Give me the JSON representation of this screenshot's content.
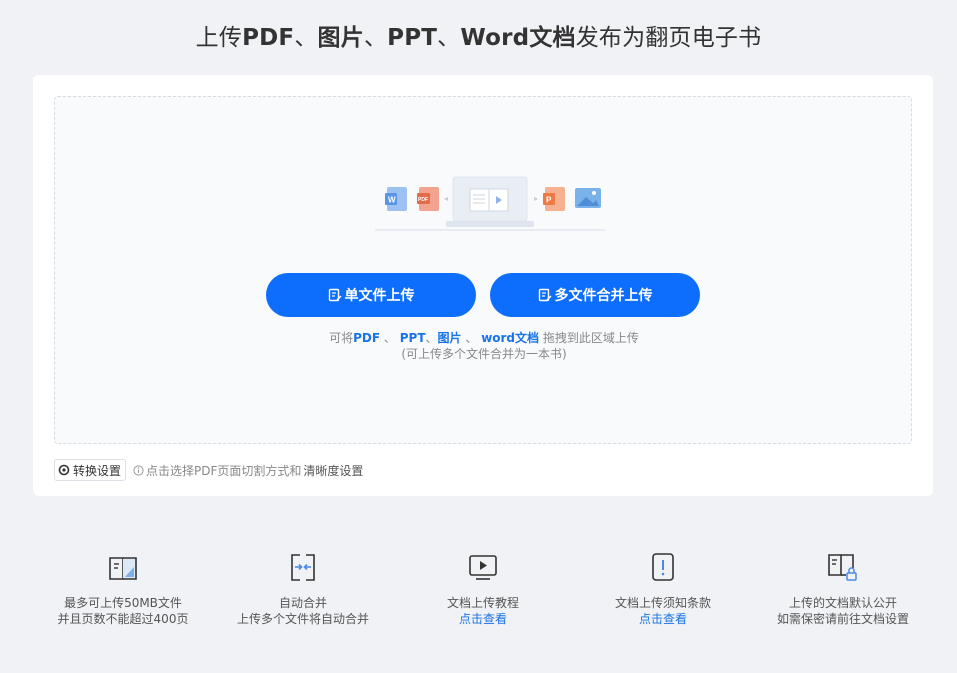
{
  "header": {
    "title_parts": [
      "上传",
      "PDF",
      "、",
      "图片",
      "、",
      "PPT",
      "、",
      "Word文档",
      "发布为翻页电子书"
    ]
  },
  "upload": {
    "illustration_icons": [
      "word-icon",
      "pdf-icon",
      "laptop-book-icon",
      "ppt-icon",
      "image-icon"
    ],
    "single_button_label": "单文件上传",
    "multi_button_label": "多文件合并上传",
    "hint_line1": {
      "prefix": "可将",
      "pdf": "PDF",
      "sep1": " 、 ",
      "ppt": "PPT",
      "sep2": "、",
      "img": "图片",
      "sep3": " 、 ",
      "word": "word文档",
      "suffix": " 拖拽到此区域上传"
    },
    "hint_line2": "(可上传多个文件合并为一本书)"
  },
  "settings": {
    "button_label": "转换设置",
    "tip_prefix": "点击选择PDF页面切割方式和",
    "tip_highlight": "清晰度设置"
  },
  "features": [
    {
      "icon": "book-icon",
      "line1": "最多可上传50MB文件",
      "line2": "并且页数不能超过400页",
      "link": false
    },
    {
      "icon": "merge-icon",
      "line1": "自动合并",
      "line2": "上传多个文件将自动合并",
      "link": false
    },
    {
      "icon": "play-video-icon",
      "line1": "文档上传教程",
      "line2": "点击查看",
      "link": true
    },
    {
      "icon": "notice-icon",
      "line1": "文档上传须知条款",
      "line2": "点击查看",
      "link": true
    },
    {
      "icon": "book-lock-icon",
      "line1": "上传的文档默认公开",
      "line2": "如需保密请前往文档设置",
      "link": false
    }
  ],
  "colors": {
    "accent": "#0d6efd",
    "link": "#1a73e8",
    "background": "#f0f2f5"
  }
}
